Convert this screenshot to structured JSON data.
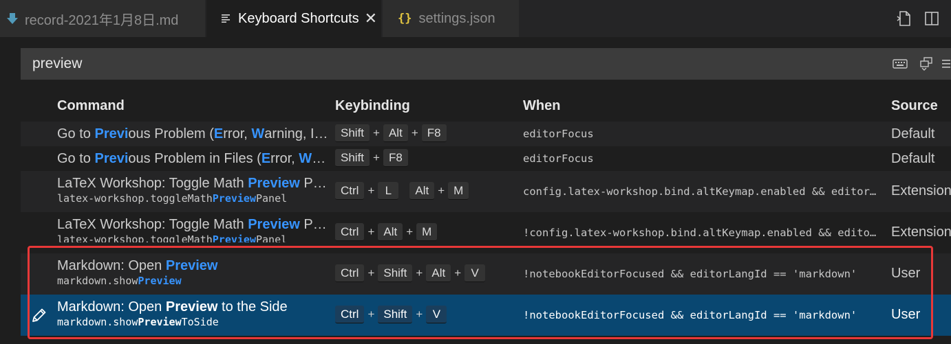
{
  "tabs": [
    {
      "label": "record-2021年1月8日.md",
      "icon": "markdown-download-icon",
      "active": false
    },
    {
      "label": "Keyboard Shortcuts",
      "icon": "keyboard-shortcuts-list-icon",
      "active": true,
      "close": "✕"
    },
    {
      "label": "settings.json",
      "icon": "json-braces-icon",
      "active": false,
      "icon_text": "{}"
    }
  ],
  "editor_actions": [
    "open-keybindings-json-icon",
    "split-editor-icon"
  ],
  "search": {
    "value": "preview",
    "actions": [
      "record-keys-icon",
      "sort-by-precedence-icon",
      "more-actions-icon"
    ]
  },
  "columns": {
    "command": "Command",
    "keybinding": "Keybinding",
    "when": "When",
    "source": "Source"
  },
  "rows": [
    {
      "title": [
        {
          "t": "Go to ",
          "hl": false
        },
        {
          "t": "Previ",
          "hl": true
        },
        {
          "t": "ous Problem (",
          "hl": false
        },
        {
          "t": "E",
          "hl": true
        },
        {
          "t": "rror, ",
          "hl": false
        },
        {
          "t": "W",
          "hl": true
        },
        {
          "t": "arning, Info)",
          "hl": false
        }
      ],
      "command_id": null,
      "keys": [
        [
          "Shift",
          "Alt",
          "F8"
        ]
      ],
      "when": "editorFocus",
      "source": "Default"
    },
    {
      "title": [
        {
          "t": "Go to ",
          "hl": false
        },
        {
          "t": "Previ",
          "hl": true
        },
        {
          "t": "ous Problem in Files (",
          "hl": false
        },
        {
          "t": "E",
          "hl": true
        },
        {
          "t": "rror, ",
          "hl": false
        },
        {
          "t": "W",
          "hl": true
        },
        {
          "t": "ar...",
          "hl": false
        }
      ],
      "command_id": null,
      "keys": [
        [
          "Shift",
          "F8"
        ]
      ],
      "when": "editorFocus",
      "source": "Default"
    },
    {
      "title": [
        {
          "t": "LaTeX Workshop: Toggle Math ",
          "hl": false
        },
        {
          "t": "Preview",
          "hl": true
        },
        {
          "t": " Panel",
          "hl": false
        }
      ],
      "command_id": [
        {
          "t": "latex-workshop.toggleMath",
          "hl": false
        },
        {
          "t": "Preview",
          "hl": true
        },
        {
          "t": "Panel",
          "hl": false
        }
      ],
      "keys": [
        [
          "Ctrl",
          "L"
        ],
        [
          "Alt",
          "M"
        ]
      ],
      "when": "config.latex-workshop.bind.altKeymap.enabled && editorTextFocus",
      "source": "Extension"
    },
    {
      "title": [
        {
          "t": "LaTeX Workshop: Toggle Math ",
          "hl": false
        },
        {
          "t": "Preview",
          "hl": true
        },
        {
          "t": " Panel",
          "hl": false
        }
      ],
      "command_id": [
        {
          "t": "latex-workshop.toggleMath",
          "hl": false
        },
        {
          "t": "Preview",
          "hl": true
        },
        {
          "t": "Panel",
          "hl": false
        }
      ],
      "keys": [
        [
          "Ctrl",
          "Alt",
          "M"
        ]
      ],
      "when": "!config.latex-workshop.bind.altKeymap.enabled && editorTextFocus",
      "source": "Extension"
    },
    {
      "title": [
        {
          "t": "Markdown: Open ",
          "hl": false
        },
        {
          "t": "Preview",
          "hl": true
        }
      ],
      "command_id": [
        {
          "t": "markdown.show",
          "hl": false
        },
        {
          "t": "Preview",
          "hl": true
        }
      ],
      "keys": [
        [
          "Ctrl",
          "Shift",
          "Alt",
          "V"
        ]
      ],
      "when": "!notebookEditorFocused && editorLangId == 'markdown'",
      "source": "User"
    },
    {
      "title": [
        {
          "t": "Markdown: Open ",
          "hl": false
        },
        {
          "t": "Preview",
          "hl": true
        },
        {
          "t": " to the Side",
          "hl": false
        }
      ],
      "command_id": [
        {
          "t": "markdown.show",
          "hl": false
        },
        {
          "t": "Preview",
          "hl": true
        },
        {
          "t": "ToSide",
          "hl": false
        }
      ],
      "keys": [
        [
          "Ctrl",
          "Shift",
          "V"
        ]
      ],
      "when": "!notebookEditorFocused && editorLangId == 'markdown'",
      "source": "User",
      "selected": true,
      "row_icon": "edit-pencil-icon"
    }
  ],
  "colors": {
    "background": "#1e1e1e",
    "row_alt": "#252526",
    "selected": "#094771",
    "highlight": "#3794ff",
    "annotation": "#e83838"
  }
}
